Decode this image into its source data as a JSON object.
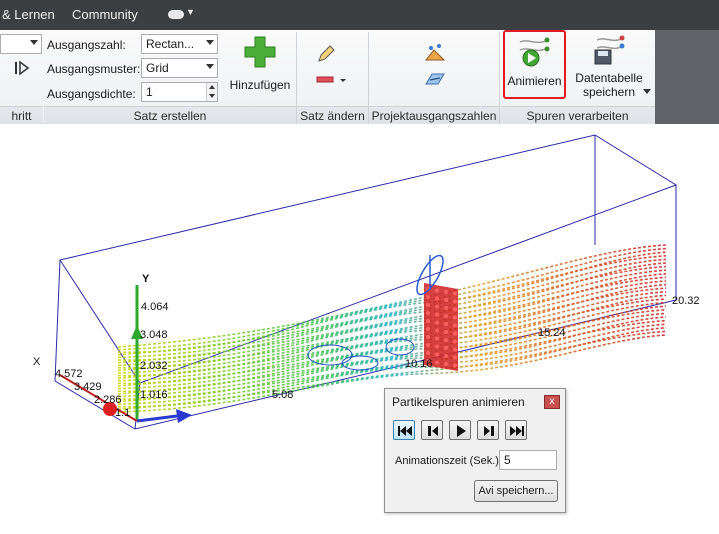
{
  "menu": {
    "items": [
      "& Lernen",
      "Community"
    ]
  },
  "ribbon": {
    "fields": {
      "ausgangszahl_label": "Ausgangszahl:",
      "ausgangszahl_value": "Rectan...",
      "ausgangsmuster_label": "Ausgangsmuster:",
      "ausgangsmuster_value": "Grid",
      "ausgangsdichte_label": "Ausgangsdichte:",
      "ausgangsdichte_value": "1"
    },
    "buttons": {
      "hinzufuegen": "Hinzufügen",
      "animieren": "Animieren",
      "datentabelle_line1": "Datentabelle",
      "datentabelle_line2": "speichern"
    },
    "groups": {
      "schritt": "hritt",
      "satz_erstellen": "Satz erstellen",
      "satz_aendern": "Satz ändern",
      "projektausgangszahlen": "Projektausgangszahlen",
      "spuren_verarbeiten": "Spuren verarbeiten"
    },
    "colors": {
      "highlight": "#e01b24",
      "plus_green": "#4caf3a"
    }
  },
  "viewport": {
    "axis_y_label": "Y",
    "axis_x_label": "X",
    "y_ticks": [
      "4.064",
      "3.048",
      "2.032",
      "1.016"
    ],
    "x_ticks": [
      "4.572",
      "3.429",
      "2.286",
      "1.1"
    ],
    "z_ticks": [
      "5.08",
      "10.16",
      "15.24",
      "20.32"
    ]
  },
  "dialog": {
    "title": "Partikelspuren animieren",
    "close_glyph": "x",
    "anim_time_label": "Animationszeit (Sek.)",
    "anim_time_value": "5",
    "save_avi": "Avi speichern..."
  }
}
